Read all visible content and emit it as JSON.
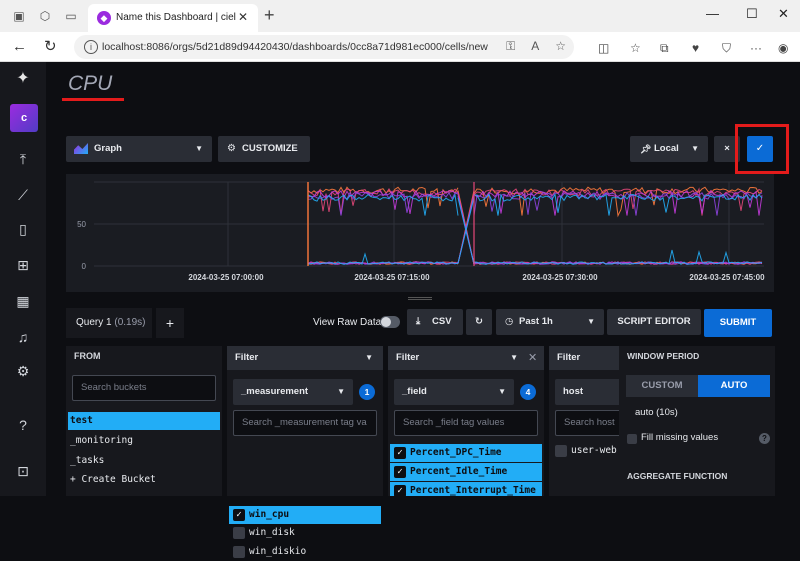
{
  "browser": {
    "tab_title": "Name this Dashboard | ciel | Influ",
    "favicon_glyph": "◆",
    "url": "localhost:8086/orgs/5d21d89d94420430/dashboards/0cc8a71d981ec000/cells/new"
  },
  "cell": {
    "title": "CPU"
  },
  "toolbar": {
    "view_type": "Graph",
    "customize_label": "CUSTOMIZE",
    "timezone": "Local",
    "cancel_glyph": "×",
    "confirm_glyph": "✓"
  },
  "chart_data": {
    "type": "line",
    "y_ticks": [
      "50",
      "0"
    ],
    "x_ticks": [
      "2024-03-25 07:00:00",
      "2024-03-25 07:15:00",
      "2024-03-25 07:30:00",
      "2024-03-25 07:45:00"
    ],
    "series_colors": [
      "#ff7a3d",
      "#e5487a",
      "#c23bd9",
      "#8e44e0",
      "#22adf6"
    ],
    "ylim": [
      0,
      100
    ]
  },
  "query": {
    "tab_label": "Query 1",
    "tab_duration": "(0.19s)",
    "add_glyph": "+",
    "view_raw_label": "View Raw Data",
    "csv_label": "CSV",
    "time_range": "Past 1h",
    "script_editor_label": "SCRIPT EDITOR",
    "submit_label": "SUBMIT"
  },
  "from_panel": {
    "header": "FROM",
    "search_placeholder": "Search buckets",
    "buckets": [
      "test",
      "_monitoring",
      "_tasks",
      "+ Create Bucket"
    ]
  },
  "filter1": {
    "header": "Filter",
    "key": "_measurement",
    "count": "1",
    "search_placeholder": "Search _measurement tag va",
    "values": [
      "win_cpu",
      "win_disk",
      "win_diskio"
    ]
  },
  "filter2": {
    "header": "Filter",
    "key": "_field",
    "count": "4",
    "search_placeholder": "Search _field tag values",
    "values": [
      "Percent_DPC_Time",
      "Percent_Idle_Time",
      "Percent_Interrupt_Time"
    ]
  },
  "filter3": {
    "header": "Filter",
    "key": "host",
    "search_placeholder": "Search host",
    "values": [
      "user-web"
    ]
  },
  "window_panel": {
    "header": "WINDOW PERIOD",
    "custom_label": "CUSTOM",
    "auto_label": "AUTO",
    "auto_value": "auto (10s)",
    "fill_label": "Fill missing values",
    "aggregate_header": "AGGREGATE FUNCTION"
  }
}
